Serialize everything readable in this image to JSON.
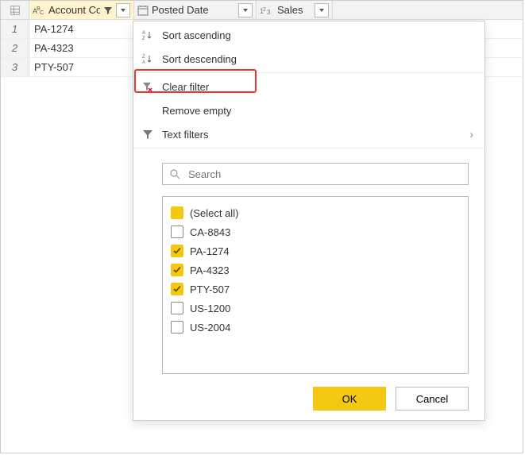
{
  "columns": [
    {
      "label": "Account Code",
      "type": "text",
      "filter_applied": true
    },
    {
      "label": "Posted Date",
      "type": "date"
    },
    {
      "label": "Sales",
      "type": "number"
    }
  ],
  "rows": [
    {
      "index": "1",
      "account_code": "PA-1274"
    },
    {
      "index": "2",
      "account_code": "PA-4323"
    },
    {
      "index": "3",
      "account_code": "PTY-507"
    }
  ],
  "menu": {
    "sort_asc": "Sort ascending",
    "sort_desc": "Sort descending",
    "clear_filter": "Clear filter",
    "remove_empty": "Remove empty",
    "text_filters": "Text filters",
    "search_placeholder": "Search"
  },
  "filter_values": [
    {
      "label": "(Select all)",
      "checked": "partial"
    },
    {
      "label": "CA-8843",
      "checked": false
    },
    {
      "label": "PA-1274",
      "checked": true
    },
    {
      "label": "PA-4323",
      "checked": true
    },
    {
      "label": "PTY-507",
      "checked": true
    },
    {
      "label": "US-1200",
      "checked": false
    },
    {
      "label": "US-2004",
      "checked": false
    }
  ],
  "buttons": {
    "ok": "OK",
    "cancel": "Cancel"
  },
  "accent_color": "#f2c811",
  "highlighted_menu_item": "clear_filter"
}
